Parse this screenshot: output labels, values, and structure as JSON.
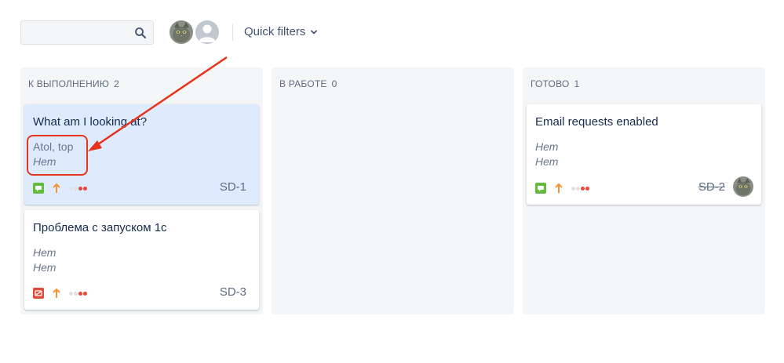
{
  "toolbar": {
    "search": {
      "value": "",
      "placeholder": "",
      "icon": "search-icon"
    },
    "avatars": [
      {
        "name": "user-avatar-cat",
        "icon": "avatar-photo"
      },
      {
        "name": "unassigned-avatar",
        "icon": "person-placeholder-icon"
      }
    ],
    "quick_filters_label": "Quick filters"
  },
  "columns": [
    {
      "title": "К ВЫПОЛНЕНИЮ",
      "count": "2",
      "cards": [
        {
          "title": "What am I looking at?",
          "field1": "Atol, top",
          "field2": "Нет",
          "key": "SD-1",
          "type_color": "#63ba3c",
          "selected": true
        },
        {
          "title": "Проблема с запуском 1с",
          "field1": "Нет",
          "field2": "Нет",
          "key": "SD-3",
          "type_color": "#e5493a",
          "selected": false
        }
      ]
    },
    {
      "title": "В РАБОТЕ",
      "count": "0",
      "cards": []
    },
    {
      "title": "ГОТОВО",
      "count": "1",
      "cards": [
        {
          "title": "Email requests enabled",
          "field1": "Нет",
          "field2": "Нет",
          "key": "SD-2",
          "type_color": "#63ba3c",
          "selected": false,
          "done": true
        }
      ]
    }
  ],
  "colors": {
    "priority": "#f79232",
    "annotation": "#e8331c",
    "column_bg": "#f4f5f7",
    "selected_card_bg": "#deebff"
  }
}
